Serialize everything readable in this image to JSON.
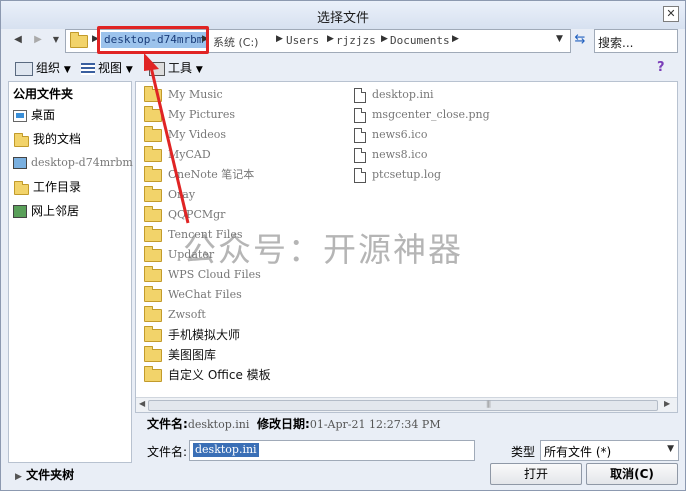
{
  "window": {
    "title": "选择文件",
    "close_glyph": "✕"
  },
  "nav": {
    "breadcrumbs": [
      "desktop-d74mrbm",
      "系统 (C:)",
      "Users",
      "rjzjzs",
      "Documents"
    ],
    "search_placeholder": "搜索..."
  },
  "toolbar": {
    "organize": "组织",
    "views": "视图",
    "tools": "工具"
  },
  "left_panel": {
    "header": "公用文件夹",
    "items": [
      {
        "label": "桌面",
        "icon": "desktop-icon"
      },
      {
        "label": "我的文档",
        "icon": "documents-icon"
      },
      {
        "label": "desktop-d74mrbm",
        "icon": "computer-icon"
      },
      {
        "label": "工作目录",
        "icon": "work-folder-icon"
      },
      {
        "label": "网上邻居",
        "icon": "network-icon"
      }
    ]
  },
  "files": {
    "col1": [
      "My Music",
      "My Pictures",
      "My Videos",
      "MyCAD",
      "OneNote 笔记本",
      "Oray",
      "QQPCMgr",
      "Tencent Files",
      "Updater",
      "WPS Cloud Files",
      "WeChat Files",
      "Zwsoft",
      "手机模拟大师",
      "美图图库",
      "自定义 Office 模板"
    ],
    "col2": [
      "desktop.ini",
      "msgcenter_close.png",
      "news6.ico",
      "news8.ico",
      "ptcsetup.log"
    ]
  },
  "info": {
    "name_label": "文件名:",
    "name_value": "desktop.ini",
    "date_label": "修改日期:",
    "date_value": "01-Apr-21 12:27:34 PM"
  },
  "footer": {
    "filename_label": "文件名:",
    "filename_value": "desktop.ini",
    "type_label": "类型",
    "type_value": "所有文件 (*)",
    "folder_tree": "文件夹树",
    "open": "打开",
    "cancel": "取消(C)"
  },
  "watermark": "公众号：开源神器",
  "colors": {
    "highlight": "#9cc3ec",
    "annotation_red": "#e02424",
    "selection": "#3a6fb6"
  }
}
